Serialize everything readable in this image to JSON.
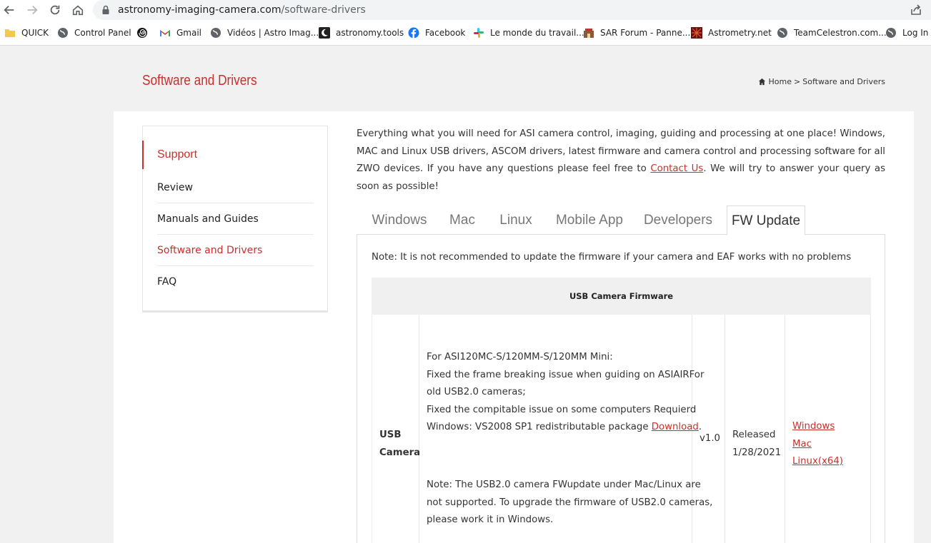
{
  "browser": {
    "url_host": "astronomy-imaging-camera.com",
    "url_path": "/software-drivers",
    "bookmarks": [
      {
        "label": "QUICK",
        "icon": "folder-icon"
      },
      {
        "label": "Control Panel",
        "icon": "globe-icon"
      },
      {
        "label": "",
        "icon": "spiral-icon"
      },
      {
        "label": "Gmail",
        "icon": "gmail-icon"
      },
      {
        "label": "Vidéos | Astro Imag...",
        "icon": "globe-icon"
      },
      {
        "label": "astronomy.tools",
        "icon": "moon-icon"
      },
      {
        "label": "Facebook",
        "icon": "facebook-icon"
      },
      {
        "label": "Le monde du travail...",
        "icon": "slack-icon"
      },
      {
        "label": "SAR Forum - Panne...",
        "icon": "sar-forum-icon"
      },
      {
        "label": "Astrometry.net",
        "icon": "astrometry-icon"
      },
      {
        "label": "TeamCelestron.com...",
        "icon": "globe-icon"
      },
      {
        "label": "Log In",
        "icon": "globe-icon"
      }
    ]
  },
  "header": {
    "title": "Software and Drivers",
    "breadcrumb": {
      "home": "Home",
      "separator": ">",
      "current": "Software and Drivers"
    }
  },
  "sidebar": {
    "heading": "Support",
    "items": [
      {
        "label": "Review"
      },
      {
        "label": "Manuals and Guides"
      },
      {
        "label": "Software and Drivers"
      },
      {
        "label": "FAQ"
      }
    ]
  },
  "intro": {
    "text_before": "Everything what  you will need for ASI camera control, imaging, guiding and processing at one place! Windows, MAC and Linux USB drivers, ASCOM drivers, latest firmware and camera control and processing software for all ZWO devices. If you have any questions please feel free to ",
    "link": "Contact Us",
    "text_after": ". We will try to answer your query as soon as possible!"
  },
  "tabs": [
    "Windows",
    "Mac",
    "Linux",
    "Mobile App",
    "Developers",
    "FW Update"
  ],
  "active_tab": "FW Update",
  "fw_update": {
    "note": "Note: It is not recommended to update the firmware if your camera and EAF works with no problems",
    "table_header": "USB Camera Firmware",
    "row": {
      "camera_line1": "USB",
      "camera_line2": "Camera",
      "desc_lines": [
        "For ASI120MC-S/120MM-S/120MM Mini:",
        "Fixed the frame breaking issue when guiding on ASIAIRFor",
        "old USB2.0 cameras;",
        "Fixed the compitable issue on some computers Requierd"
      ],
      "desc_line5_before": "Windows: VS2008 SP1 redistributable package ",
      "desc_line5_link": "Download",
      "desc_line5_after": ".",
      "note_lines": [
        "Note: The USB2.0 camera FWupdate under Mac/Linux are",
        "not supported. To upgrade the firmware of USB2.0 cameras,",
        "please work it in Windows."
      ],
      "version": "v1.0",
      "released_line1": "Released",
      "released_line2": "1/28/2021",
      "downloads": [
        "Windows",
        "Mac",
        "Linux(x64)"
      ]
    }
  },
  "colors": {
    "accent": "#c9302c",
    "band": "#f1f1f1",
    "table_header_bg": "#f0f0f0"
  }
}
